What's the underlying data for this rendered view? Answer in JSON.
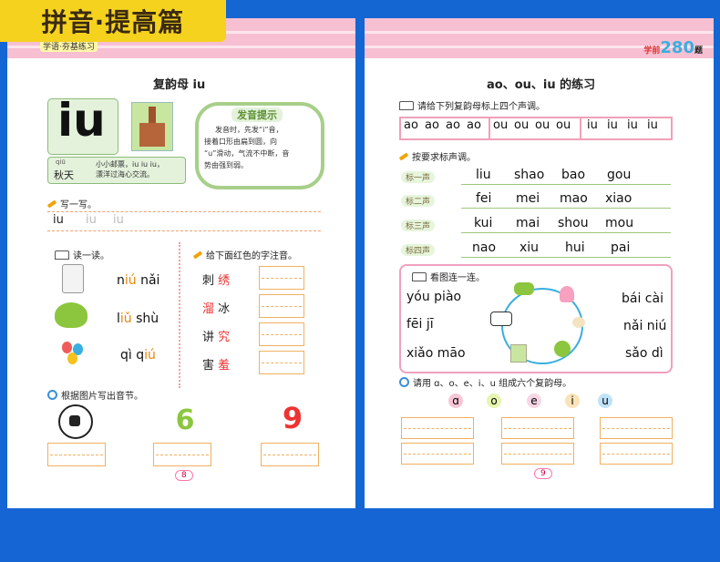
{
  "banner": "拼音·提高篇",
  "left": {
    "header_tag": "学语·夯基练习",
    "title": "复韵母 iu",
    "big_letters": "iu",
    "word_pinyin": "qiū",
    "word": "秋天",
    "poem_lines": [
      "小小邮票，iu iu iu，",
      "漂洋过海心交流。"
    ],
    "tip_title": "发音提示",
    "tip_lines": [
      "发音时，先发“i”音，",
      "接着口形由扁到圆，向",
      "“u”滑动，气流不中断，音",
      "势由强到弱。"
    ],
    "write_label": "写一写。",
    "write_samples": [
      "iu",
      "iu",
      "iu"
    ],
    "read_label": "读一读。",
    "read_items": [
      {
        "pre": "n",
        "hl": "iú",
        "post": " nǎi"
      },
      {
        "pre": "l",
        "hl": "iǔ",
        "post": " shù"
      },
      {
        "pre": "qì q",
        "hl": "iú",
        "post": ""
      }
    ],
    "zhuyin_label": "给下面红色的字注音。",
    "zhuyin_items": [
      {
        "a": "刺",
        "b": "绣",
        "red": "b"
      },
      {
        "a": "溜",
        "b": "冰",
        "red": "a"
      },
      {
        "a": "讲",
        "b": "究",
        "red": "b"
      },
      {
        "a": "害",
        "b": "羞",
        "red": "b"
      }
    ],
    "pic_label": "根据图片写出音节。",
    "page_number": "8"
  },
  "right": {
    "logo_main": "280",
    "logo_side": "学前",
    "logo_tail": "题",
    "title": "ao、ou、iu 的练习",
    "tone_label": "请给下列复韵母标上四个声调。",
    "tone_groups": [
      [
        "ao",
        "ao",
        "ao",
        "ao"
      ],
      [
        "ou",
        "ou",
        "ou",
        "ou"
      ],
      [
        "iu",
        "iu",
        "iu",
        "iu"
      ]
    ],
    "mark_label": "按要求标声调。",
    "mark_rows": [
      {
        "tag": "标一声",
        "words": [
          "liu",
          "shao",
          "bao",
          "gou"
        ]
      },
      {
        "tag": "标二声",
        "words": [
          "fei",
          "mei",
          "mao",
          "xiao"
        ]
      },
      {
        "tag": "标三声",
        "words": [
          "kui",
          "mai",
          "shou",
          "mou"
        ]
      },
      {
        "tag": "标四声",
        "words": [
          "nao",
          "xiu",
          "hui",
          "pai"
        ]
      }
    ],
    "connect_label": "看图连一连。",
    "connect_left": [
      "yóu piào",
      "fēi jī",
      "xiǎo māo"
    ],
    "connect_right": [
      "bái cài",
      "nǎi niú",
      "sǎo dì"
    ],
    "compose_label": "请用 ɑ、o、e、i、u 组成六个复韵母。",
    "vowels": [
      "ɑ",
      "o",
      "e",
      "i",
      "u"
    ],
    "vowel_colors": [
      "#f7c6d6",
      "#e6f5b0",
      "#f7d6e6",
      "#fbe3b8",
      "#bfe3f7"
    ],
    "page_number": "9"
  }
}
